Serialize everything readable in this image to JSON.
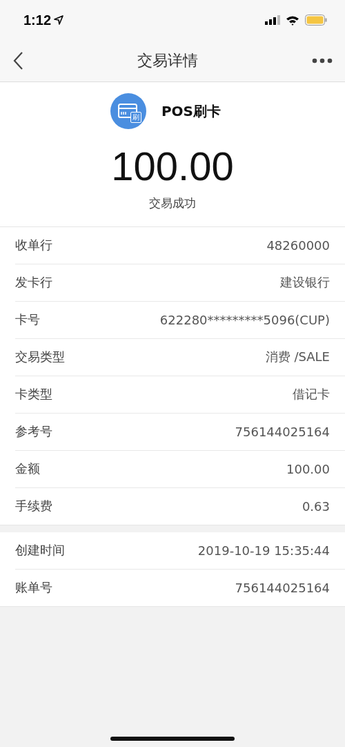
{
  "status_bar": {
    "time": "1:12"
  },
  "nav": {
    "title": "交易详情"
  },
  "summary": {
    "method": "POS刷卡",
    "icon_badge": "刷",
    "amount": "100.00",
    "status": "交易成功"
  },
  "groups": [
    {
      "rows": [
        {
          "label": "收单行",
          "value": "48260000"
        },
        {
          "label": "发卡行",
          "value": "建设银行"
        },
        {
          "label": "卡号",
          "value": "622280*********5096(CUP)"
        },
        {
          "label": "交易类型",
          "value": "消费 /SALE"
        },
        {
          "label": "卡类型",
          "value": "借记卡"
        },
        {
          "label": "参考号",
          "value": "756144025164"
        },
        {
          "label": "金额",
          "value": "100.00"
        },
        {
          "label": "手续费",
          "value": "0.63"
        }
      ]
    },
    {
      "rows": [
        {
          "label": "创建时间",
          "value": "2019-10-19 15:35:44"
        },
        {
          "label": "账单号",
          "value": "756144025164"
        }
      ]
    }
  ]
}
